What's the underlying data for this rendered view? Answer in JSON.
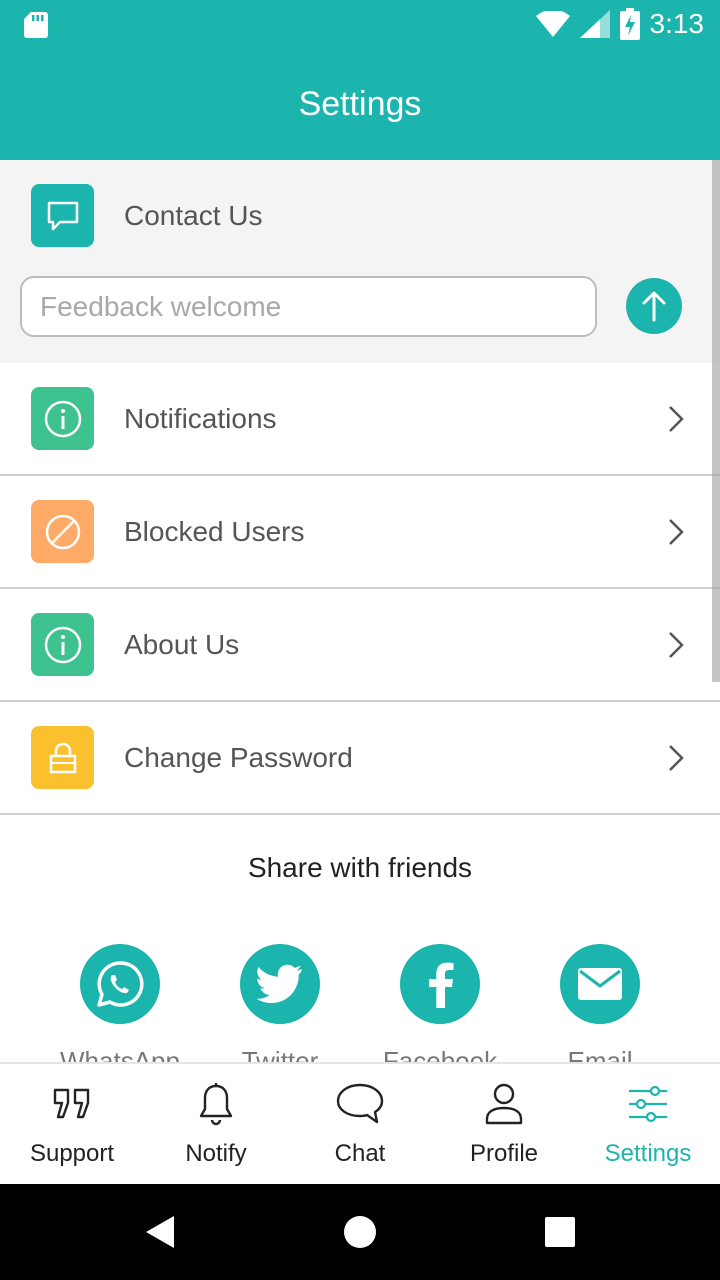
{
  "status_bar": {
    "time": "3:13",
    "icons": [
      "sd-card-icon",
      "wifi-icon",
      "signal-icon",
      "battery-charging-icon"
    ]
  },
  "header": {
    "title": "Settings"
  },
  "contact": {
    "label": "Contact Us",
    "icon": "chat-bubble-icon",
    "feedback_placeholder": "Feedback welcome",
    "feedback_value": "",
    "send_icon": "arrow-up-icon"
  },
  "menu": {
    "items": [
      {
        "label": "Notifications",
        "icon": "info-icon",
        "color": "#3ec28f"
      },
      {
        "label": "Blocked Users",
        "icon": "block-icon",
        "color": "#ffaa66"
      },
      {
        "label": "About Us",
        "icon": "info-icon",
        "color": "#3ec28f"
      },
      {
        "label": "Change Password",
        "icon": "lock-icon",
        "color": "#fbc02d"
      }
    ]
  },
  "share": {
    "title": "Share with friends",
    "items": [
      {
        "label": "WhatsApp",
        "icon": "whatsapp-icon"
      },
      {
        "label": "Twitter",
        "icon": "twitter-icon"
      },
      {
        "label": "Facebook",
        "icon": "facebook-icon"
      },
      {
        "label": "Email",
        "icon": "email-icon"
      }
    ]
  },
  "bottom_nav": {
    "items": [
      {
        "label": "Support",
        "icon": "quote-icon"
      },
      {
        "label": "Notify",
        "icon": "bell-icon"
      },
      {
        "label": "Chat",
        "icon": "chat-bubble-icon"
      },
      {
        "label": "Profile",
        "icon": "person-icon"
      },
      {
        "label": "Settings",
        "icon": "sliders-icon"
      }
    ],
    "active": "Settings"
  },
  "colors": {
    "primary": "#1bb5ad",
    "info": "#3ec28f",
    "block": "#ffaa66",
    "lock": "#fbc02d"
  }
}
